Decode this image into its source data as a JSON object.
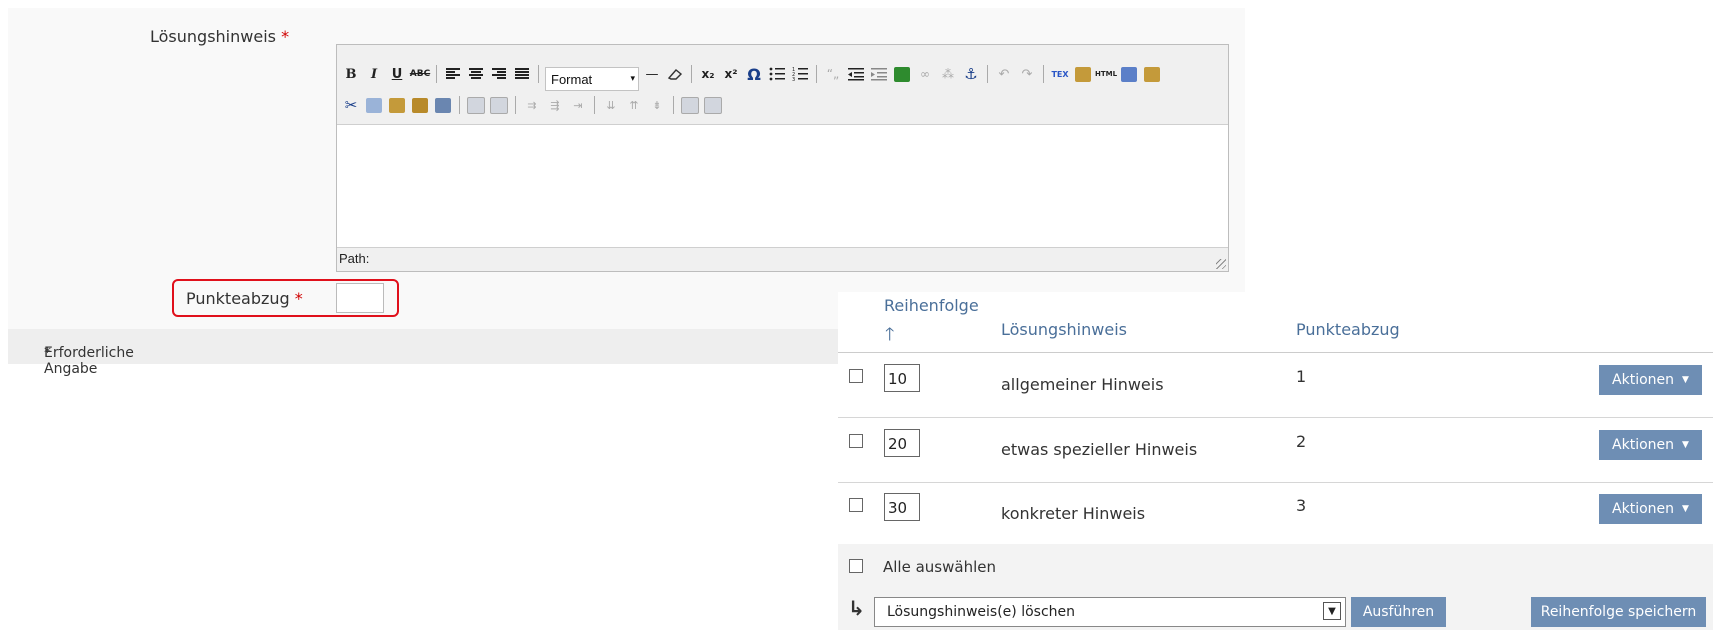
{
  "form": {
    "hint_label": "Lösungshinweis",
    "points_label": "Punkteabzug",
    "required_marker": "*",
    "required_note": "Erforderliche Angabe",
    "editor": {
      "format_label": "Format",
      "path_label": "Path:",
      "toolbar_row1": [
        "bold-icon",
        "italic-icon",
        "underline-icon",
        "strikethrough-icon",
        "align-left-icon",
        "align-center-icon",
        "align-right-icon",
        "align-justify-icon",
        "format-select",
        "horizontal-rule-icon",
        "eraser-icon",
        "subscript-icon",
        "superscript-icon",
        "omega-icon",
        "bullet-list-icon",
        "numbered-list-icon",
        "blockquote-icon",
        "outdent-icon",
        "indent-icon",
        "image-icon",
        "link-icon",
        "unlink-icon",
        "anchor-icon",
        "undo-icon",
        "redo-icon",
        "tex-icon",
        "paste-word-icon",
        "html-icon",
        "fullscreen-icon",
        "insert-media-icon"
      ],
      "toolbar_row2": [
        "cut-icon",
        "copy-icon",
        "paste-icon",
        "paste-text-icon",
        "edit-icon",
        "table-icon",
        "cell-props-icon",
        "insert-row-before-icon",
        "insert-row-after-icon",
        "delete-row-icon",
        "insert-col-before-icon",
        "insert-col-after-icon",
        "delete-col-icon",
        "split-cells-icon",
        "merge-cells-icon"
      ],
      "glyphs": {
        "bold": "B",
        "italic": "I",
        "underline": "U",
        "strike": "ABC",
        "sub": "x₂",
        "sup": "x²",
        "omega": "Ω",
        "hr": "—",
        "tex": "TEX",
        "html": "HTML"
      }
    }
  },
  "table": {
    "headers": {
      "order": "Reihenfolge",
      "hint": "Lösungshinweis",
      "points": "Punkteabzug"
    },
    "sort_arrow": "🡑",
    "rows": [
      {
        "order": "10",
        "hint": "allgemeiner Hinweis",
        "points": "1",
        "action": "Aktionen"
      },
      {
        "order": "20",
        "hint": "etwas spezieller Hinweis",
        "points": "2",
        "action": "Aktionen"
      },
      {
        "order": "30",
        "hint": "konkreter Hinweis",
        "points": "3",
        "action": "Aktionen"
      }
    ],
    "select_all_label": "Alle auswählen",
    "bulk_arrow": "↳",
    "bulk_action_value": "Lösungshinweis(e) löschen",
    "execute_label": "Ausführen",
    "save_order_label": "Reihenfolge speichern"
  },
  "colors": {
    "accent": "#6e8eb4",
    "header_text": "#4a6f99",
    "required": "#d00000",
    "highlight": "#e0101b"
  }
}
